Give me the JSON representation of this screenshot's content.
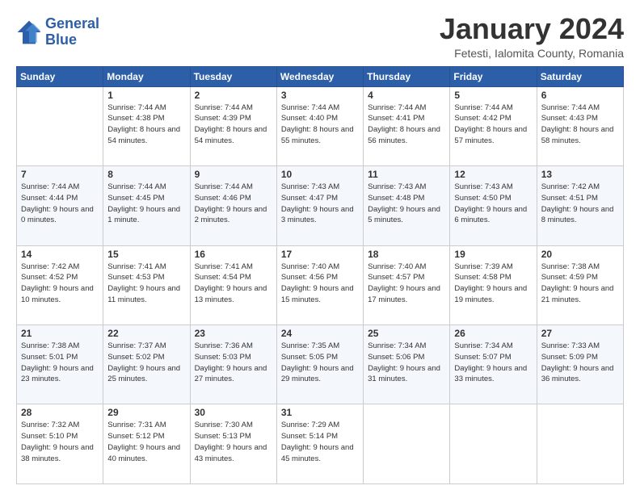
{
  "logo": {
    "line1": "General",
    "line2": "Blue"
  },
  "title": "January 2024",
  "subtitle": "Fetesti, Ialomita County, Romania",
  "days_of_week": [
    "Sunday",
    "Monday",
    "Tuesday",
    "Wednesday",
    "Thursday",
    "Friday",
    "Saturday"
  ],
  "weeks": [
    [
      {
        "day": "",
        "sunrise": "",
        "sunset": "",
        "daylight": ""
      },
      {
        "day": "1",
        "sunrise": "Sunrise: 7:44 AM",
        "sunset": "Sunset: 4:38 PM",
        "daylight": "Daylight: 8 hours and 54 minutes."
      },
      {
        "day": "2",
        "sunrise": "Sunrise: 7:44 AM",
        "sunset": "Sunset: 4:39 PM",
        "daylight": "Daylight: 8 hours and 54 minutes."
      },
      {
        "day": "3",
        "sunrise": "Sunrise: 7:44 AM",
        "sunset": "Sunset: 4:40 PM",
        "daylight": "Daylight: 8 hours and 55 minutes."
      },
      {
        "day": "4",
        "sunrise": "Sunrise: 7:44 AM",
        "sunset": "Sunset: 4:41 PM",
        "daylight": "Daylight: 8 hours and 56 minutes."
      },
      {
        "day": "5",
        "sunrise": "Sunrise: 7:44 AM",
        "sunset": "Sunset: 4:42 PM",
        "daylight": "Daylight: 8 hours and 57 minutes."
      },
      {
        "day": "6",
        "sunrise": "Sunrise: 7:44 AM",
        "sunset": "Sunset: 4:43 PM",
        "daylight": "Daylight: 8 hours and 58 minutes."
      }
    ],
    [
      {
        "day": "7",
        "sunrise": "Sunrise: 7:44 AM",
        "sunset": "Sunset: 4:44 PM",
        "daylight": "Daylight: 9 hours and 0 minutes."
      },
      {
        "day": "8",
        "sunrise": "Sunrise: 7:44 AM",
        "sunset": "Sunset: 4:45 PM",
        "daylight": "Daylight: 9 hours and 1 minute."
      },
      {
        "day": "9",
        "sunrise": "Sunrise: 7:44 AM",
        "sunset": "Sunset: 4:46 PM",
        "daylight": "Daylight: 9 hours and 2 minutes."
      },
      {
        "day": "10",
        "sunrise": "Sunrise: 7:43 AM",
        "sunset": "Sunset: 4:47 PM",
        "daylight": "Daylight: 9 hours and 3 minutes."
      },
      {
        "day": "11",
        "sunrise": "Sunrise: 7:43 AM",
        "sunset": "Sunset: 4:48 PM",
        "daylight": "Daylight: 9 hours and 5 minutes."
      },
      {
        "day": "12",
        "sunrise": "Sunrise: 7:43 AM",
        "sunset": "Sunset: 4:50 PM",
        "daylight": "Daylight: 9 hours and 6 minutes."
      },
      {
        "day": "13",
        "sunrise": "Sunrise: 7:42 AM",
        "sunset": "Sunset: 4:51 PM",
        "daylight": "Daylight: 9 hours and 8 minutes."
      }
    ],
    [
      {
        "day": "14",
        "sunrise": "Sunrise: 7:42 AM",
        "sunset": "Sunset: 4:52 PM",
        "daylight": "Daylight: 9 hours and 10 minutes."
      },
      {
        "day": "15",
        "sunrise": "Sunrise: 7:41 AM",
        "sunset": "Sunset: 4:53 PM",
        "daylight": "Daylight: 9 hours and 11 minutes."
      },
      {
        "day": "16",
        "sunrise": "Sunrise: 7:41 AM",
        "sunset": "Sunset: 4:54 PM",
        "daylight": "Daylight: 9 hours and 13 minutes."
      },
      {
        "day": "17",
        "sunrise": "Sunrise: 7:40 AM",
        "sunset": "Sunset: 4:56 PM",
        "daylight": "Daylight: 9 hours and 15 minutes."
      },
      {
        "day": "18",
        "sunrise": "Sunrise: 7:40 AM",
        "sunset": "Sunset: 4:57 PM",
        "daylight": "Daylight: 9 hours and 17 minutes."
      },
      {
        "day": "19",
        "sunrise": "Sunrise: 7:39 AM",
        "sunset": "Sunset: 4:58 PM",
        "daylight": "Daylight: 9 hours and 19 minutes."
      },
      {
        "day": "20",
        "sunrise": "Sunrise: 7:38 AM",
        "sunset": "Sunset: 4:59 PM",
        "daylight": "Daylight: 9 hours and 21 minutes."
      }
    ],
    [
      {
        "day": "21",
        "sunrise": "Sunrise: 7:38 AM",
        "sunset": "Sunset: 5:01 PM",
        "daylight": "Daylight: 9 hours and 23 minutes."
      },
      {
        "day": "22",
        "sunrise": "Sunrise: 7:37 AM",
        "sunset": "Sunset: 5:02 PM",
        "daylight": "Daylight: 9 hours and 25 minutes."
      },
      {
        "day": "23",
        "sunrise": "Sunrise: 7:36 AM",
        "sunset": "Sunset: 5:03 PM",
        "daylight": "Daylight: 9 hours and 27 minutes."
      },
      {
        "day": "24",
        "sunrise": "Sunrise: 7:35 AM",
        "sunset": "Sunset: 5:05 PM",
        "daylight": "Daylight: 9 hours and 29 minutes."
      },
      {
        "day": "25",
        "sunrise": "Sunrise: 7:34 AM",
        "sunset": "Sunset: 5:06 PM",
        "daylight": "Daylight: 9 hours and 31 minutes."
      },
      {
        "day": "26",
        "sunrise": "Sunrise: 7:34 AM",
        "sunset": "Sunset: 5:07 PM",
        "daylight": "Daylight: 9 hours and 33 minutes."
      },
      {
        "day": "27",
        "sunrise": "Sunrise: 7:33 AM",
        "sunset": "Sunset: 5:09 PM",
        "daylight": "Daylight: 9 hours and 36 minutes."
      }
    ],
    [
      {
        "day": "28",
        "sunrise": "Sunrise: 7:32 AM",
        "sunset": "Sunset: 5:10 PM",
        "daylight": "Daylight: 9 hours and 38 minutes."
      },
      {
        "day": "29",
        "sunrise": "Sunrise: 7:31 AM",
        "sunset": "Sunset: 5:12 PM",
        "daylight": "Daylight: 9 hours and 40 minutes."
      },
      {
        "day": "30",
        "sunrise": "Sunrise: 7:30 AM",
        "sunset": "Sunset: 5:13 PM",
        "daylight": "Daylight: 9 hours and 43 minutes."
      },
      {
        "day": "31",
        "sunrise": "Sunrise: 7:29 AM",
        "sunset": "Sunset: 5:14 PM",
        "daylight": "Daylight: 9 hours and 45 minutes."
      },
      {
        "day": "",
        "sunrise": "",
        "sunset": "",
        "daylight": ""
      },
      {
        "day": "",
        "sunrise": "",
        "sunset": "",
        "daylight": ""
      },
      {
        "day": "",
        "sunrise": "",
        "sunset": "",
        "daylight": ""
      }
    ]
  ]
}
